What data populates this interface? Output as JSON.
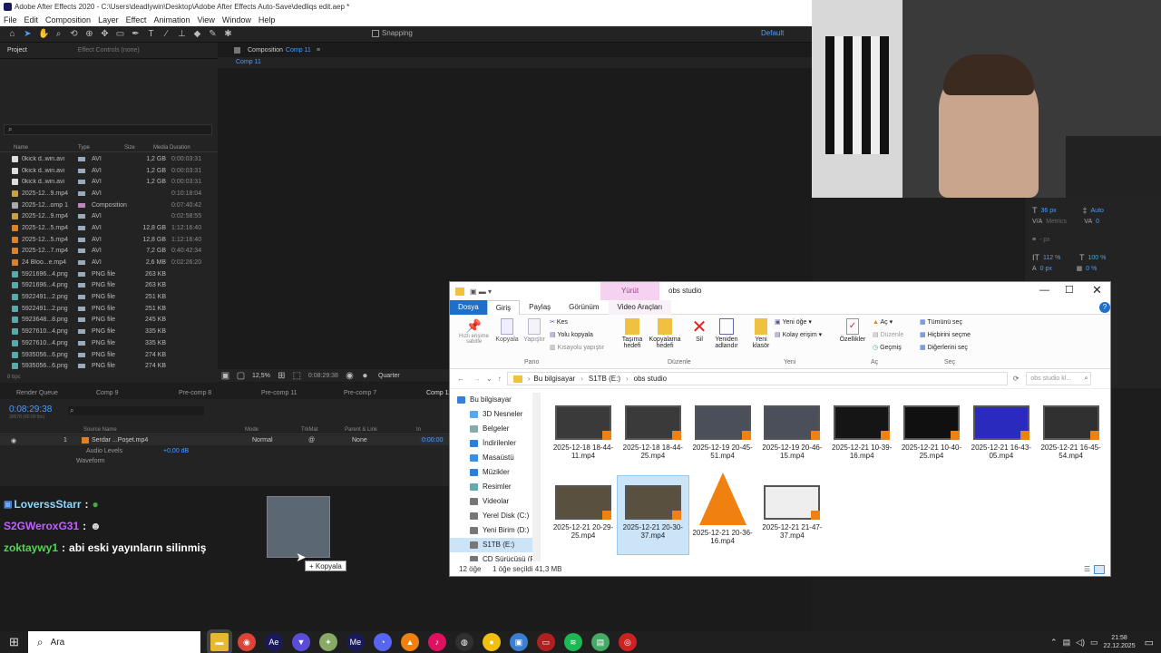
{
  "ae": {
    "title": "Adobe After Effects 2020 - C:\\Users\\deadlywin\\Desktop\\Adobe After Effects Auto-Save\\dedliqs edit.aep *",
    "menu": [
      "File",
      "Edit",
      "Composition",
      "Layer",
      "Effect",
      "Animation",
      "View",
      "Window",
      "Help"
    ],
    "snapping": "Snapping",
    "workspace": "Default",
    "project_tab": "Project",
    "effect_controls_tab": "Effect Controls (none)",
    "comp_panel_label": "Composition",
    "comp_name": "Comp 11",
    "comp_tab": "Comp 11",
    "project_columns": {
      "name": "Name",
      "type": "Type",
      "size": "Size",
      "duration": "Media Duration"
    },
    "project_items": [
      {
        "name": "0kick d..win.avi",
        "type": "AVI",
        "size": "1,2 GB",
        "duration": "0:00:03:31",
        "icon": "#ddd",
        "tag": "#9ab"
      },
      {
        "name": "0kick d..win.avi",
        "type": "AVI",
        "size": "1,2 GB",
        "duration": "0:00:03:31",
        "icon": "#ddd",
        "tag": "#9ab"
      },
      {
        "name": "0kick d..win.avi",
        "type": "AVI",
        "size": "1,2 GB",
        "duration": "0:00:03:31",
        "icon": "#ddd",
        "tag": "#9ab"
      },
      {
        "name": "2025-12...9.mp4",
        "type": "AVI",
        "size": "",
        "duration": "0:10:18:04",
        "icon": "#c9a23b",
        "tag": "#9ab"
      },
      {
        "name": "2025-12...omp 1",
        "type": "Composition",
        "size": "",
        "duration": "0:07:40:42",
        "icon": "#aaa",
        "tag": "#b8b"
      },
      {
        "name": "2025-12...9.mp4",
        "type": "AVI",
        "size": "",
        "duration": "0:02:58:55",
        "icon": "#c9a23b",
        "tag": "#9ab"
      },
      {
        "name": "2025-12...5.mp4",
        "type": "AVI",
        "size": "12,8 GB",
        "duration": "1:12:16:40",
        "icon": "#e08020",
        "tag": "#9ab"
      },
      {
        "name": "2025-12...5.mp4",
        "type": "AVI",
        "size": "12,8 GB",
        "duration": "1:12:16:40",
        "icon": "#e08020",
        "tag": "#9ab"
      },
      {
        "name": "2025-12...7.mp4",
        "type": "AVI",
        "size": "7,2 GB",
        "duration": "0:40:42:34",
        "icon": "#e08020",
        "tag": "#9ab"
      },
      {
        "name": "24 Bloo...e.mp4",
        "type": "AVI",
        "size": "2,6 MB",
        "duration": "0:02:26:20",
        "icon": "#e08020",
        "tag": "#9ab"
      },
      {
        "name": "5921696...4.png",
        "type": "PNG file",
        "size": "263 KB",
        "duration": "",
        "icon": "#5aa",
        "tag": "#9ab"
      },
      {
        "name": "5921696...4.png",
        "type": "PNG file",
        "size": "263 KB",
        "duration": "",
        "icon": "#5aa",
        "tag": "#9ab"
      },
      {
        "name": "5922491...2.png",
        "type": "PNG file",
        "size": "251 KB",
        "duration": "",
        "icon": "#5aa",
        "tag": "#9ab"
      },
      {
        "name": "5922491...2.png",
        "type": "PNG file",
        "size": "251 KB",
        "duration": "",
        "icon": "#5aa",
        "tag": "#9ab"
      },
      {
        "name": "5923648...8.png",
        "type": "PNG file",
        "size": "245 KB",
        "duration": "",
        "icon": "#5aa",
        "tag": "#9ab"
      },
      {
        "name": "5927610...4.png",
        "type": "PNG file",
        "size": "335 KB",
        "duration": "",
        "icon": "#5aa",
        "tag": "#9ab"
      },
      {
        "name": "5927610...4.png",
        "type": "PNG file",
        "size": "335 KB",
        "duration": "",
        "icon": "#5aa",
        "tag": "#9ab"
      },
      {
        "name": "5935056...6.png",
        "type": "PNG file",
        "size": "274 KB",
        "duration": "",
        "icon": "#5aa",
        "tag": "#9ab"
      },
      {
        "name": "5935056...6.png",
        "type": "PNG file",
        "size": "274 KB",
        "duration": "",
        "icon": "#5aa",
        "tag": "#9ab"
      }
    ],
    "project_footer": "8 bpc",
    "viewer": {
      "zoom": "12,5%",
      "timecode": "0:08:29:38",
      "resolution": "Quarter"
    },
    "timeline_tabs": [
      "Render Queue",
      "Comp 9",
      "Pre-comp 8",
      "Pre-comp 11",
      "Pre-comp 7",
      "Comp 11"
    ],
    "timeline": {
      "timecode": "0:08:29:38",
      "fps_note": "30578 (60.00 fps)",
      "columns": {
        "source": "Source Name",
        "mode": "Mode",
        "trkmat": "TrkMat",
        "parent": "Parent & Link",
        "in": "In"
      },
      "layer_num": "1",
      "layer_name": "Serdar ...Poşet.mp4",
      "layer_mode": "Normal",
      "layer_parent": "None",
      "layer_in": "0:00:00",
      "audio_levels": "Audio Levels",
      "audio_value": "+0,00 dB",
      "waveform": "Waveform"
    },
    "right_panel": {
      "font_size": "36 px",
      "auto": "Auto",
      "metrics": "Metrics",
      "tracking": "0",
      "leading": "- px",
      "vscale": "112 %",
      "hscale": "100 %",
      "baseline": "0 px",
      "tsume": "0 %"
    },
    "drag_tooltip": "+ Kopyala"
  },
  "chat": [
    {
      "user": "LoverssStarr",
      "text": "",
      "color": "#8fd8ff"
    },
    {
      "user": "S2GWeroxG31",
      "text": "",
      "color": "#c061ff"
    },
    {
      "user": "zoktaywy1",
      "text": "abi eski yayınların silinmiş",
      "color": "#4fd84f"
    }
  ],
  "explorer": {
    "context_tab": "Yürüt",
    "title": "obs studio",
    "tabs": [
      "Dosya",
      "Giriş",
      "Paylaş",
      "Görünüm",
      "Video Araçları"
    ],
    "ribbon": {
      "pin": "Hızlı erişime sabitle",
      "copy": "Kopyala",
      "paste": "Yapıştır",
      "cut": "Kes",
      "copy_path": "Yolu kopyala",
      "paste_shortcut": "Kısayolu yapıştır",
      "group_clipboard": "Pano",
      "move_to": "Taşıma hedefi",
      "copy_to": "Kopyalama hedefi",
      "delete": "Sil",
      "rename": "Yeniden adlandır",
      "group_organize": "Düzenle",
      "new_folder": "Yeni klasör",
      "new_item": "Yeni öğe",
      "easy_access": "Kolay erişim",
      "group_new": "Yeni",
      "properties": "Özellikler",
      "open": "Aç",
      "edit": "Düzenle",
      "history": "Geçmiş",
      "group_open": "Aç",
      "select_all": "Tümünü seç",
      "select_none": "Hiçbirini seçme",
      "invert": "Diğerlerini seç",
      "group_select": "Seç"
    },
    "breadcrumb": [
      "Bu bilgisayar",
      "S1TB (E:)",
      "obs studio"
    ],
    "search_placeholder": "obs studio kl...",
    "nav": [
      {
        "label": "Bu bilgisayar",
        "color": "#3a7fd5"
      },
      {
        "label": "3D Nesneler",
        "color": "#59a7e8"
      },
      {
        "label": "Belgeler",
        "color": "#8aa"
      },
      {
        "label": "İndirilenler",
        "color": "#2d7fd8"
      },
      {
        "label": "Masaüstü",
        "color": "#3a8fe0"
      },
      {
        "label": "Müzikler",
        "color": "#2d7fd8"
      },
      {
        "label": "Resimler",
        "color": "#6aa"
      },
      {
        "label": "Videolar",
        "color": "#777"
      },
      {
        "label": "Yerel Disk (C:)",
        "color": "#777"
      },
      {
        "label": "Yeni Birim (D:)",
        "color": "#777"
      },
      {
        "label": "S1TB (E:)",
        "color": "#777"
      },
      {
        "label": "CD Sürücüsü (F",
        "color": "#777"
      }
    ],
    "files": [
      {
        "name": "2025-12-18 18-44-11.mp4",
        "color": "#3a3a3a",
        "kind": "video",
        "selected": false
      },
      {
        "name": "2025-12-18 18-44-25.mp4",
        "color": "#3a3a3a",
        "kind": "video",
        "selected": false
      },
      {
        "name": "2025-12-19 20-45-51.mp4",
        "color": "#4a4f5a",
        "kind": "video",
        "selected": false
      },
      {
        "name": "2025-12-19 20-46-15.mp4",
        "color": "#4a4f5a",
        "kind": "video",
        "selected": false
      },
      {
        "name": "2025-12-21 10-39-16.mp4",
        "color": "#151515",
        "kind": "video",
        "selected": false
      },
      {
        "name": "2025-12-21 10-40-25.mp4",
        "color": "#101010",
        "kind": "video",
        "selected": false
      },
      {
        "name": "2025-12-21 16-43-05.mp4",
        "color": "#2a2abf",
        "kind": "video",
        "selected": false
      },
      {
        "name": "2025-12-21 16-45-54.mp4",
        "color": "#303030",
        "kind": "video",
        "selected": false
      },
      {
        "name": "2025-12-21 20-29-25.mp4",
        "color": "#5a5040",
        "kind": "video",
        "selected": false
      },
      {
        "name": "2025-12-21 20-30-37.mp4",
        "color": "#5a5040",
        "kind": "video",
        "selected": true
      },
      {
        "name": "2025-12-21 20-36-16.mp4",
        "color": "#f08010",
        "kind": "vlc",
        "selected": false
      },
      {
        "name": "2025-12-21 21-47-37.mp4",
        "color": "#eeeeee",
        "kind": "video",
        "selected": false
      }
    ],
    "status_count": "12 öğe",
    "status_selected": "1 öğe seçildi  41,3 MB"
  },
  "taskbar": {
    "search": "Ara",
    "apps": [
      {
        "name": "file-explorer-icon",
        "bg": "#e8b830",
        "glyph": "▬"
      },
      {
        "name": "chrome-icon",
        "bg": "#db4437",
        "glyph": "◉"
      },
      {
        "name": "after-effects-icon",
        "bg": "#1a1a5a",
        "glyph": "Ae"
      },
      {
        "name": "brave-icon",
        "bg": "#5a4bd8",
        "glyph": "▼"
      },
      {
        "name": "app-icon",
        "bg": "#8a6",
        "glyph": "✦"
      },
      {
        "name": "media-encoder-icon",
        "bg": "#1a1a5a",
        "glyph": "Me"
      },
      {
        "name": "discord-icon",
        "bg": "#5865f2",
        "glyph": "◔"
      },
      {
        "name": "vlc-icon",
        "bg": "#f08010",
        "glyph": "▲"
      },
      {
        "name": "tiktok-icon",
        "bg": "#e01060",
        "glyph": "♪"
      },
      {
        "name": "obs-icon",
        "bg": "#303030",
        "glyph": "◍"
      },
      {
        "name": "maps-icon",
        "bg": "#f0c010",
        "glyph": "●"
      },
      {
        "name": "photos-icon",
        "bg": "#3a7fd5",
        "glyph": "▣"
      },
      {
        "name": "mixer-icon",
        "bg": "#b02020",
        "glyph": "▭"
      },
      {
        "name": "spotify-icon",
        "bg": "#1db954",
        "glyph": "≋"
      },
      {
        "name": "app2-icon",
        "bg": "#4a6",
        "glyph": "▤"
      },
      {
        "name": "app3-icon",
        "bg": "#c22",
        "glyph": "◎"
      }
    ],
    "time": "21:58",
    "date": "22.12.2025"
  }
}
